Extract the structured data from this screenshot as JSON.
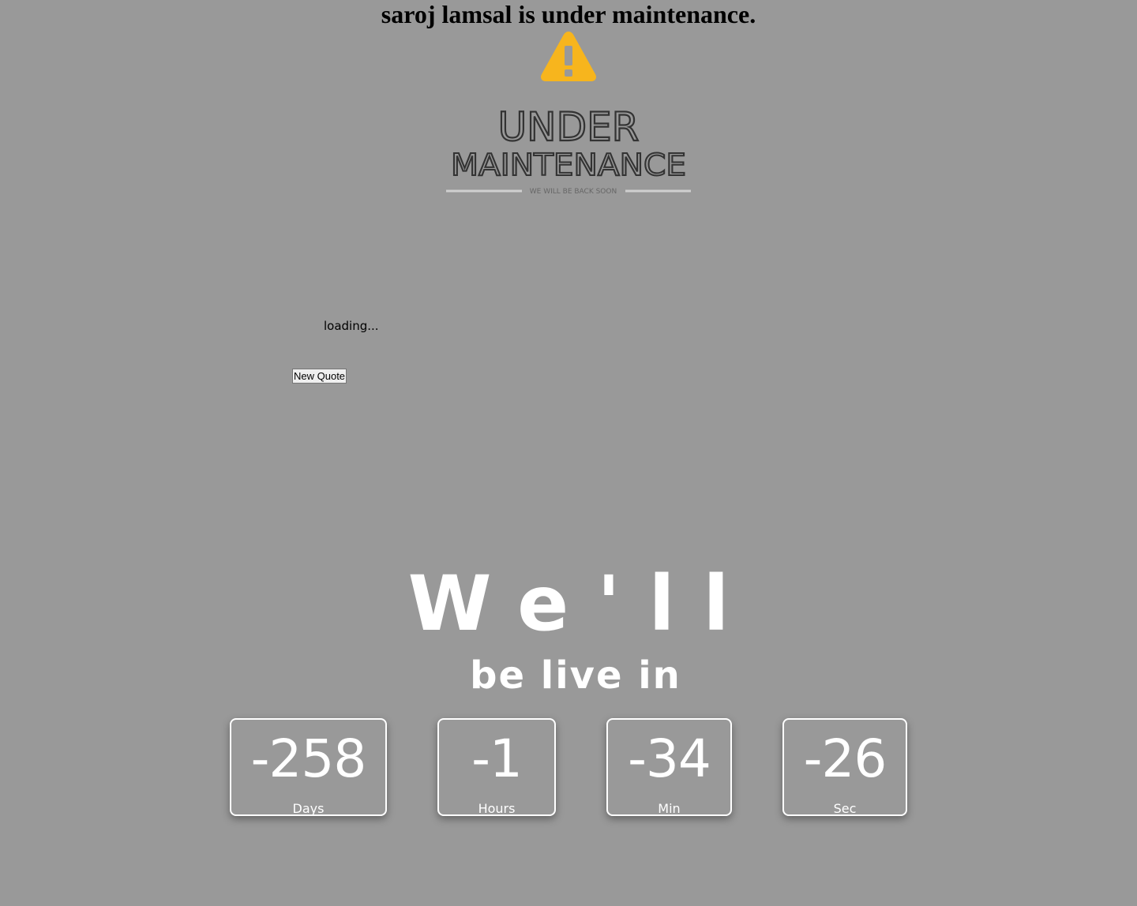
{
  "header": {
    "title": "saroj lamsal is under maintenance."
  },
  "logo": {
    "icon": "warning-icon",
    "icon_color": "#f7b51d",
    "line1": "UNDER",
    "line2": "MAINTENANCE",
    "tagline": "WE WILL BE BACK SOON"
  },
  "quote": {
    "text": "loading...",
    "button_label": "New Quote"
  },
  "headline": {
    "big": "We'll",
    "sub": "be live in"
  },
  "countdown": {
    "days": {
      "value": "-258",
      "label": "Days"
    },
    "hours": {
      "value": "-1",
      "label": "Hours"
    },
    "min": {
      "value": "-34",
      "label": "Min"
    },
    "sec": {
      "value": "-26",
      "label": "Sec"
    }
  },
  "colors": {
    "background": "#999999",
    "accent": "#f7b51d",
    "text_light": "#ffffff"
  }
}
